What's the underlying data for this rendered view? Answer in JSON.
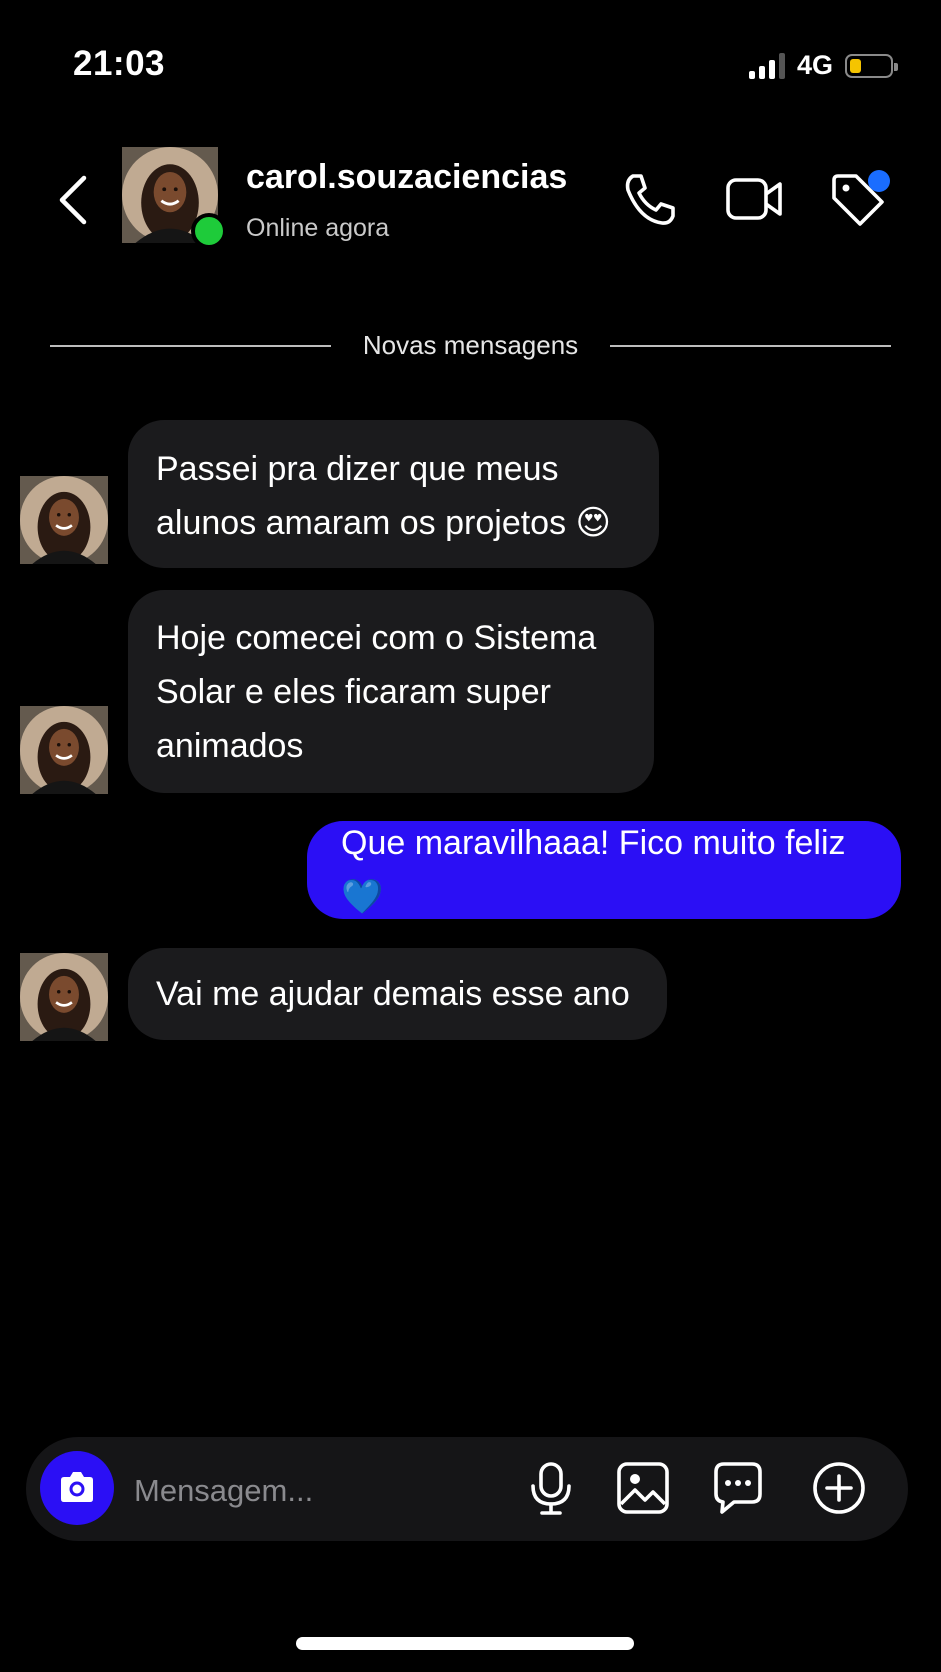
{
  "status": {
    "time": "21:03",
    "network": "4G",
    "battery_level": 0.22,
    "signal_bars_active": 3
  },
  "header": {
    "username": "carol.souzaciencias",
    "presence": "Online agora"
  },
  "divider": {
    "label": "Novas mensagens"
  },
  "messages": [
    {
      "direction": "in",
      "text": "Passei pra dizer que meus alunos amaram os projetos 😍"
    },
    {
      "direction": "in",
      "text": "Hoje comecei com o Sistema Solar e eles ficaram super animados"
    },
    {
      "direction": "out",
      "text": "Que maravilhaaa! Fico muito feliz 💙"
    },
    {
      "direction": "in",
      "text": "Vai me ajudar demais esse ano"
    }
  ],
  "composer": {
    "placeholder": "Mensagem..."
  },
  "colors": {
    "accent": "#2b0ff5",
    "online": "#1ecb3a",
    "incoming_bubble": "#1b1b1d",
    "badge": "#1a6dff"
  },
  "icons": [
    "back-chevron-icon",
    "phone-icon",
    "video-icon",
    "tag-icon",
    "camera-icon",
    "microphone-icon",
    "gallery-icon",
    "chat-bubble-icon",
    "plus-circle-icon"
  ]
}
